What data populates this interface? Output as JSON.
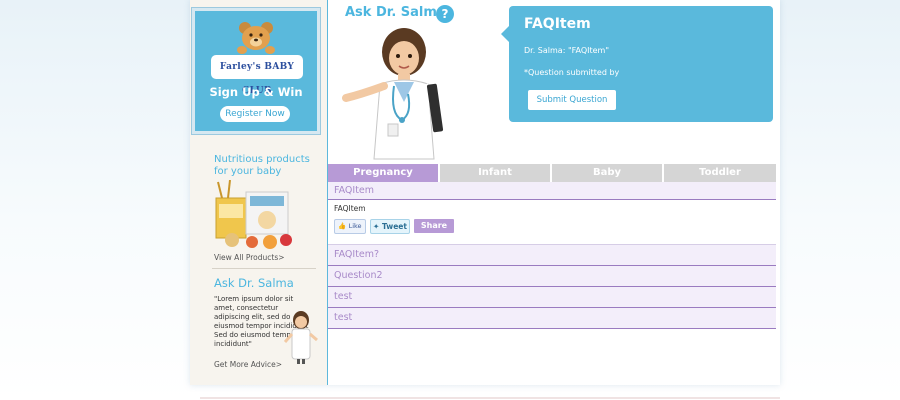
{
  "sidebar": {
    "brand_text": "Farley's BABY CLUB",
    "promo_title": "Sign Up & Win",
    "register_label": "Register Now",
    "nutrition_title": "Nutritious products for your baby",
    "view_all_label": "View All Products>",
    "ask_title": "Ask Dr. Salma",
    "ask_text": "\"Lorem ipsum dolor sit amet, consectetur adipiscing elit, sed do eiusmod tempor incididunt Sed do eiusmod tempor incididunt\"",
    "more_advice_label": "Get More Advice>"
  },
  "header": {
    "ask_title": "Ask Dr. Salma",
    "help_icon_glyph": "?"
  },
  "bubble": {
    "title": "FAQItem",
    "line1": "Dr. Salma: \"FAQItem\"",
    "line2": "*Question submitted by",
    "submit_label": "Submit Question"
  },
  "tabs": [
    {
      "label": "Pregnancy",
      "active": true
    },
    {
      "label": "Infant",
      "active": false
    },
    {
      "label": "Baby",
      "active": false
    },
    {
      "label": "Toddler",
      "active": false
    }
  ],
  "faq": {
    "expanded_question": "FAQItem",
    "expanded_answer": "FAQItem",
    "like_label": "Like",
    "tweet_label": "Tweet",
    "share_label": "Share",
    "items": [
      "FAQItem?",
      "Question2",
      "test",
      "test"
    ]
  },
  "colors": {
    "accent_blue": "#5ab9dc",
    "tab_active": "#b79ad6",
    "faq_text": "#a88ac9",
    "faq_bg": "#f3eefa"
  }
}
